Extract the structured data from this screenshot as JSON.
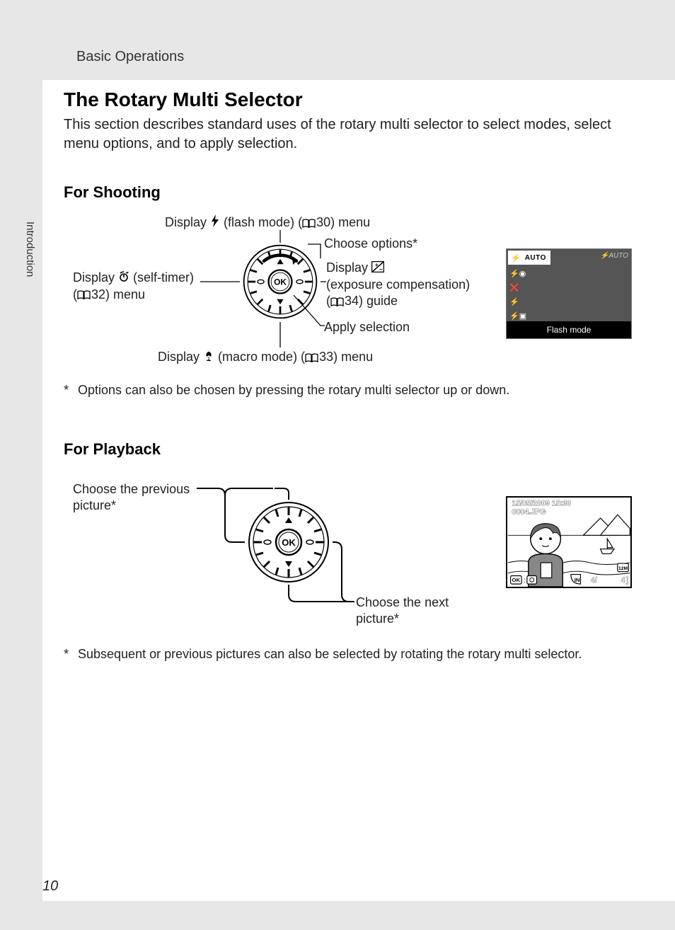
{
  "header": {
    "section": "Basic Operations"
  },
  "side_tab": "Introduction",
  "title": "The Rotary Multi Selector",
  "intro": "This section describes standard uses of the rotary multi selector to select modes, select menu options, and to apply selection.",
  "shooting": {
    "heading": "For Shooting",
    "labels": {
      "up_pre": "Display ",
      "up_mid": " (flash mode) (",
      "up_page": "30",
      "up_post": ") menu",
      "choose": "Choose options*",
      "right_line1_pre": "Display ",
      "right_line2_pre": "(exposure compensation)",
      "right_line3_pre": "(",
      "right_page": "34",
      "right_line3_post": ") guide",
      "left_line1_pre": "Display ",
      "left_line1_post": " (self-timer)",
      "left_line2_pre": "(",
      "left_page": "32",
      "left_line2_post": ") menu",
      "apply": "Apply selection",
      "down_pre": "Display ",
      "down_mid": " (macro mode) (",
      "down_page": "33",
      "down_post": ") menu"
    },
    "lcd": {
      "row1": "AUTO",
      "side": "AUTO",
      "caption": "Flash mode"
    },
    "footnote": "Options can also be chosen by pressing the rotary multi selector up or down."
  },
  "playback": {
    "heading": "For Playback",
    "labels": {
      "prev1": "Choose the previous",
      "prev2": "picture*",
      "next1": "Choose the next",
      "next2": "picture*"
    },
    "lcd": {
      "date": "15/05/2009 15:30",
      "file": "0004.JPG",
      "count": "4",
      "of": "4"
    },
    "footnote": "Subsequent or previous pictures can also be selected by rotating the rotary multi selector."
  },
  "page_number": "10",
  "icons": {
    "ok": "OK"
  }
}
